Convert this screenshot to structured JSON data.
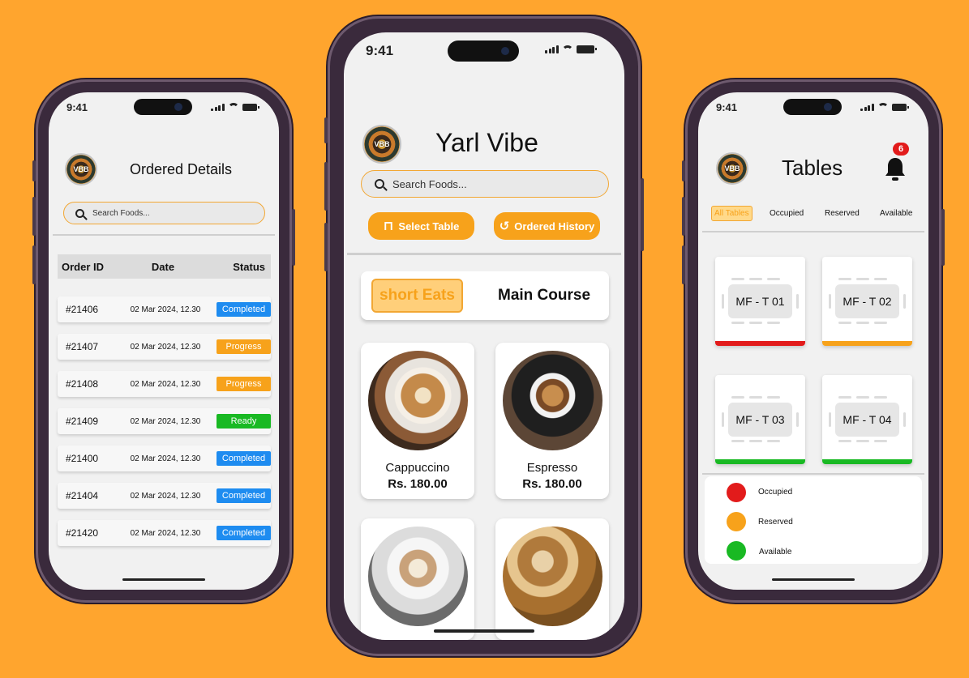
{
  "status": {
    "time": "9:41"
  },
  "orders_screen": {
    "title": "Ordered Details",
    "logo_text": "VBB",
    "search_placeholder": "Search Foods...",
    "columns": [
      "Order ID",
      "Date",
      "Status"
    ],
    "rows": [
      {
        "id": "#21406",
        "date": "02 Mar 2024, 12.30",
        "status": "Completed",
        "color": "#1e8cf0"
      },
      {
        "id": "#21407",
        "date": "02 Mar 2024, 12.30",
        "status": "Progress",
        "color": "#f7a21b"
      },
      {
        "id": "#21408",
        "date": "02 Mar 2024, 12.30",
        "status": "Progress",
        "color": "#f7a21b"
      },
      {
        "id": "#21409",
        "date": "02 Mar 2024, 12.30",
        "status": "Ready",
        "color": "#19b923"
      },
      {
        "id": "#21400",
        "date": "02 Mar 2024, 12.30",
        "status": "Completed",
        "color": "#1e8cf0"
      },
      {
        "id": "#21404",
        "date": "02 Mar 2024, 12.30",
        "status": "Completed",
        "color": "#1e8cf0"
      },
      {
        "id": "#21420",
        "date": "02 Mar 2024, 12.30",
        "status": "Completed",
        "color": "#1e8cf0"
      }
    ]
  },
  "menu_screen": {
    "title": "Yarl Vibe",
    "logo_text": "VBB",
    "search_placeholder": "Search Foods...",
    "select_table": "Select Table",
    "ordered_history": "Ordered History",
    "categories": {
      "active": "short Eats",
      "other": "Main Course"
    },
    "items": [
      {
        "name": "Cappuccino",
        "price": "Rs. 180.00"
      },
      {
        "name": "Espresso",
        "price": "Rs. 180.00"
      }
    ]
  },
  "tables_screen": {
    "title": "Tables",
    "logo_text": "VBB",
    "notification_count": "6",
    "filters": [
      "All Tables",
      "Occupied",
      "Reserved",
      "Available"
    ],
    "tables": [
      {
        "label": "MF - T 01",
        "status_color": "#e21b1b"
      },
      {
        "label": "MF - T 02",
        "status_color": "#f7a21b"
      },
      {
        "label": "MF - T 03",
        "status_color": "#19b923"
      },
      {
        "label": "MF - T 04",
        "status_color": "#19b923"
      }
    ],
    "legend": [
      {
        "label": "Occupied",
        "color": "#e21b1b"
      },
      {
        "label": "Reserved",
        "color": "#f7a21b"
      },
      {
        "label": "Available",
        "color": "#19b923"
      }
    ]
  },
  "colors": {
    "accent": "#f7a21b",
    "background": "#ffa52e"
  }
}
